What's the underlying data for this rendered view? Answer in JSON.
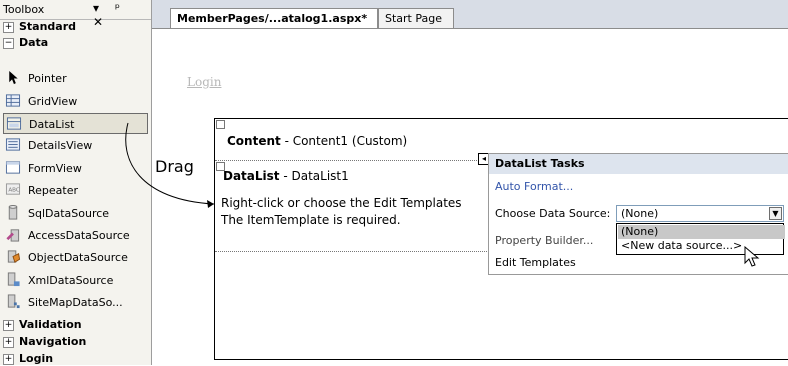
{
  "toolbox": {
    "title": "Toolbox",
    "controls": "▾ ᵖ ✕",
    "categories": {
      "standard": {
        "label": "Standard",
        "sign": "+"
      },
      "data": {
        "label": "Data",
        "sign": "−"
      },
      "validation": {
        "label": "Validation",
        "sign": "+"
      },
      "navigation": {
        "label": "Navigation",
        "sign": "+"
      },
      "login": {
        "label": "Login",
        "sign": "+"
      }
    },
    "items": [
      {
        "label": "Pointer",
        "icon": "pointer-icon"
      },
      {
        "label": "GridView",
        "icon": "gridview-icon"
      },
      {
        "label": "DataList",
        "icon": "datalist-icon"
      },
      {
        "label": "DetailsView",
        "icon": "detailsview-icon"
      },
      {
        "label": "FormView",
        "icon": "formview-icon"
      },
      {
        "label": "Repeater",
        "icon": "repeater-icon"
      },
      {
        "label": "SqlDataSource",
        "icon": "sqldatasource-icon"
      },
      {
        "label": "AccessDataSource",
        "icon": "accessdatasource-icon"
      },
      {
        "label": "ObjectDataSource",
        "icon": "objectdatasource-icon"
      },
      {
        "label": "XmlDataSource",
        "icon": "xmldatasource-icon"
      },
      {
        "label": "SiteMapDataSo...",
        "icon": "sitemapdatasource-icon"
      }
    ]
  },
  "editor": {
    "tabs": [
      "MemberPages/...atalog1.aspx*",
      "Start Page"
    ],
    "login_link": "Login",
    "content": {
      "name": "Content",
      "desc": " - Content1 (Custom)"
    },
    "datalist": {
      "name": "DataList",
      "desc": " - DataList1",
      "line1": "Right-click or choose the Edit Templates",
      "line2": "The ItemTemplate is required."
    }
  },
  "drag_label": "Drag",
  "tasks": {
    "title": "DataList Tasks",
    "auto_format": "Auto Format...",
    "choose_source_label": "Choose Data Source:",
    "choose_source_value": "(None)",
    "options": [
      "(None)",
      "<New data source...>"
    ],
    "property_builder": "Property Builder...",
    "edit_templates": "Edit Templates"
  },
  "colors": {
    "toolbox_bg": "#f4f3ee",
    "tab_strip": "#d8dde6",
    "tasks_header": "#dde4ee",
    "link": "#3355aa"
  }
}
